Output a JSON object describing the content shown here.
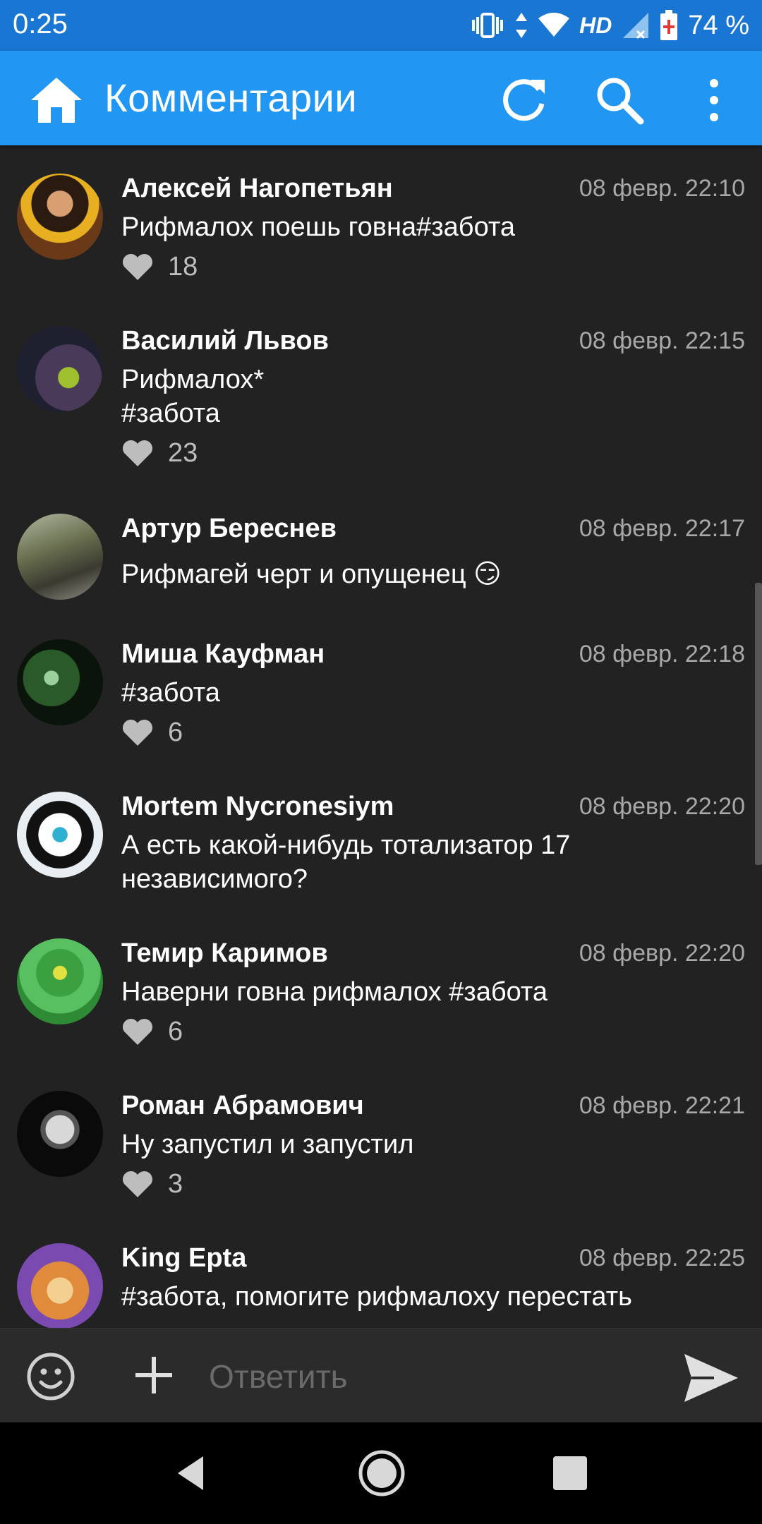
{
  "status_bar": {
    "time": "0:25",
    "network_label": "HD",
    "battery": "74 %"
  },
  "app_bar": {
    "title": "Комментарии"
  },
  "comments": [
    {
      "author": "Алексей Нагопетьян",
      "date": "08 февр. 22:10",
      "text": "Рифмалох поешь говна#забота",
      "likes": "18",
      "avatar_color": "#7a4a20"
    },
    {
      "author": "Василий Львов",
      "date": "08 февр. 22:15",
      "text": "Рифмалох*\n#забота",
      "likes": "23",
      "avatar_color": "#3b3f63"
    },
    {
      "author": "Артур Береснев",
      "date": "08 февр. 22:17",
      "text": "Рифмагей черт и опущенец 😏",
      "likes": "",
      "avatar_color": "#8c8a6e"
    },
    {
      "author": "Миша Кауфман",
      "date": "08 февр. 22:18",
      "text": "#забота",
      "likes": "6",
      "avatar_color": "#1c3b1e"
    },
    {
      "author": "Mortem Nycronesiym",
      "date": "08 февр. 22:20",
      "text": "А есть какой-нибудь тотализатор 17\nнезависимого?",
      "likes": "",
      "avatar_color": "#d9dde4"
    },
    {
      "author": "Темир Каримов",
      "date": "08 февр. 22:20",
      "text": "Наверни говна рифмалох #забота",
      "likes": "6",
      "avatar_color": "#4caf50"
    },
    {
      "author": "Роман Абрамович",
      "date": "08 февр. 22:21",
      "text": "Ну запустил и запустил",
      "likes": "3",
      "avatar_color": "#111111"
    },
    {
      "author": "King Epta",
      "date": "08 февр. 22:25",
      "text": "#забота, помогите рифмалоху  перестать",
      "likes": "",
      "avatar_color": "#e08a3c"
    }
  ],
  "reply_bar": {
    "placeholder": "Ответить"
  },
  "icons": {
    "home": "home-icon",
    "refresh": "refresh-icon",
    "search": "search-icon",
    "menu": "more-vert-icon",
    "emoji": "emoji-icon",
    "attach": "plus-icon",
    "send": "send-icon",
    "like": "heart-icon"
  },
  "colors": {
    "app_bar": "#2196f3",
    "status_bar": "#1976d2",
    "background": "#222222"
  }
}
